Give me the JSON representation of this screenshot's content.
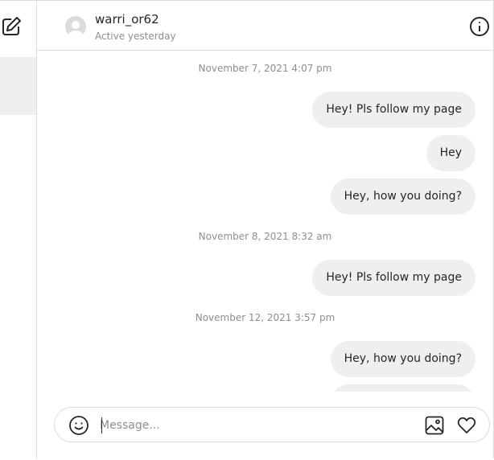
{
  "header": {
    "username": "warri_or62",
    "status": "Active yesterday"
  },
  "thread": [
    {
      "kind": "timestamp",
      "text": "November 7, 2021 4:07 pm"
    },
    {
      "kind": "message",
      "text": "Hey! Pls follow my page"
    },
    {
      "kind": "message",
      "text": "Hey"
    },
    {
      "kind": "message",
      "text": "Hey, how you doing?"
    },
    {
      "kind": "timestamp",
      "text": "November 8, 2021 8:32 am"
    },
    {
      "kind": "message",
      "text": "Hey! Pls follow my page"
    },
    {
      "kind": "timestamp",
      "text": "November 12, 2021 3:57 pm"
    },
    {
      "kind": "message",
      "text": "Hey, how you doing?"
    },
    {
      "kind": "message",
      "text": ""
    }
  ],
  "composer": {
    "placeholder": "Message...",
    "value": ""
  },
  "icons": {
    "compose": "compose-icon",
    "info": "info-icon",
    "emoji": "emoji-icon",
    "image": "image-icon",
    "heart": "heart-icon"
  }
}
